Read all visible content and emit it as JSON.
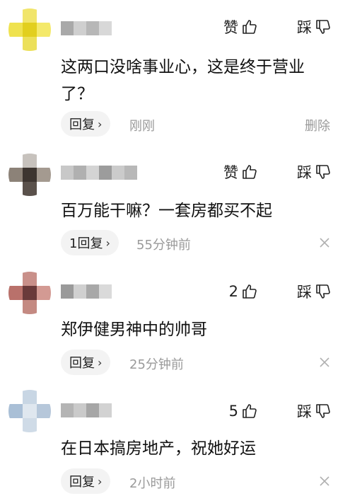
{
  "labels": {
    "like": "赞",
    "dislike": "踩",
    "delete": "删除"
  },
  "comments": [
    {
      "like_label": "赞",
      "text": "这两口没啥事业心，这是终于营业了？",
      "reply_label": "回复",
      "time": "刚刚",
      "avatar_colors": [
        "#ffffff",
        "#f1e56b",
        "#ffffff",
        "#efe24f",
        "#e2cf1e",
        "#f4e96a",
        "#ffffff",
        "#ece05a",
        "#ffffff"
      ],
      "username_colors": [
        "#a9a9a9",
        "#cfcfcf",
        "#b7b7b7",
        "#d8d8d8"
      ]
    },
    {
      "like_label": "赞",
      "text": "百万能干嘛？一套房都买不起",
      "reply_label": "1回复",
      "time": "55分钟前",
      "avatar_colors": [
        "#ffffff",
        "#c7c2bd",
        "#ffffff",
        "#8c8278",
        "#3d3530",
        "#a49a90",
        "#ffffff",
        "#5a514b",
        "#ffffff"
      ],
      "username_colors": [
        "#c8c8c8",
        "#b0b0b0",
        "#d4d4d4",
        "#9c9c9c",
        "#cbcbcb",
        "#b8b8b8"
      ]
    },
    {
      "like_label": "2",
      "text": "郑伊健男神中的帅哥",
      "reply_label": "回复",
      "time": "25分钟前",
      "avatar_colors": [
        "#ffffff",
        "#c9908a",
        "#ffffff",
        "#b9716b",
        "#6a3a3a",
        "#d39a93",
        "#ffffff",
        "#c48a82",
        "#ffffff"
      ],
      "username_colors": [
        "#9a9a9a",
        "#d0d0d0",
        "#a8a8a8",
        "#dadada"
      ]
    },
    {
      "like_label": "5",
      "text": "在日本搞房地产，祝她好运",
      "reply_label": "回复",
      "time": "2小时前",
      "avatar_colors": [
        "#ffffff",
        "#c8d6e4",
        "#ffffff",
        "#a9bfd6",
        "#dfe7ef",
        "#b6c7da",
        "#ffffff",
        "#cfdbe7",
        "#ffffff"
      ],
      "username_colors": [
        "#b4b4b4",
        "#cacaca",
        "#a6a6a6",
        "#d2d2d2"
      ]
    }
  ]
}
